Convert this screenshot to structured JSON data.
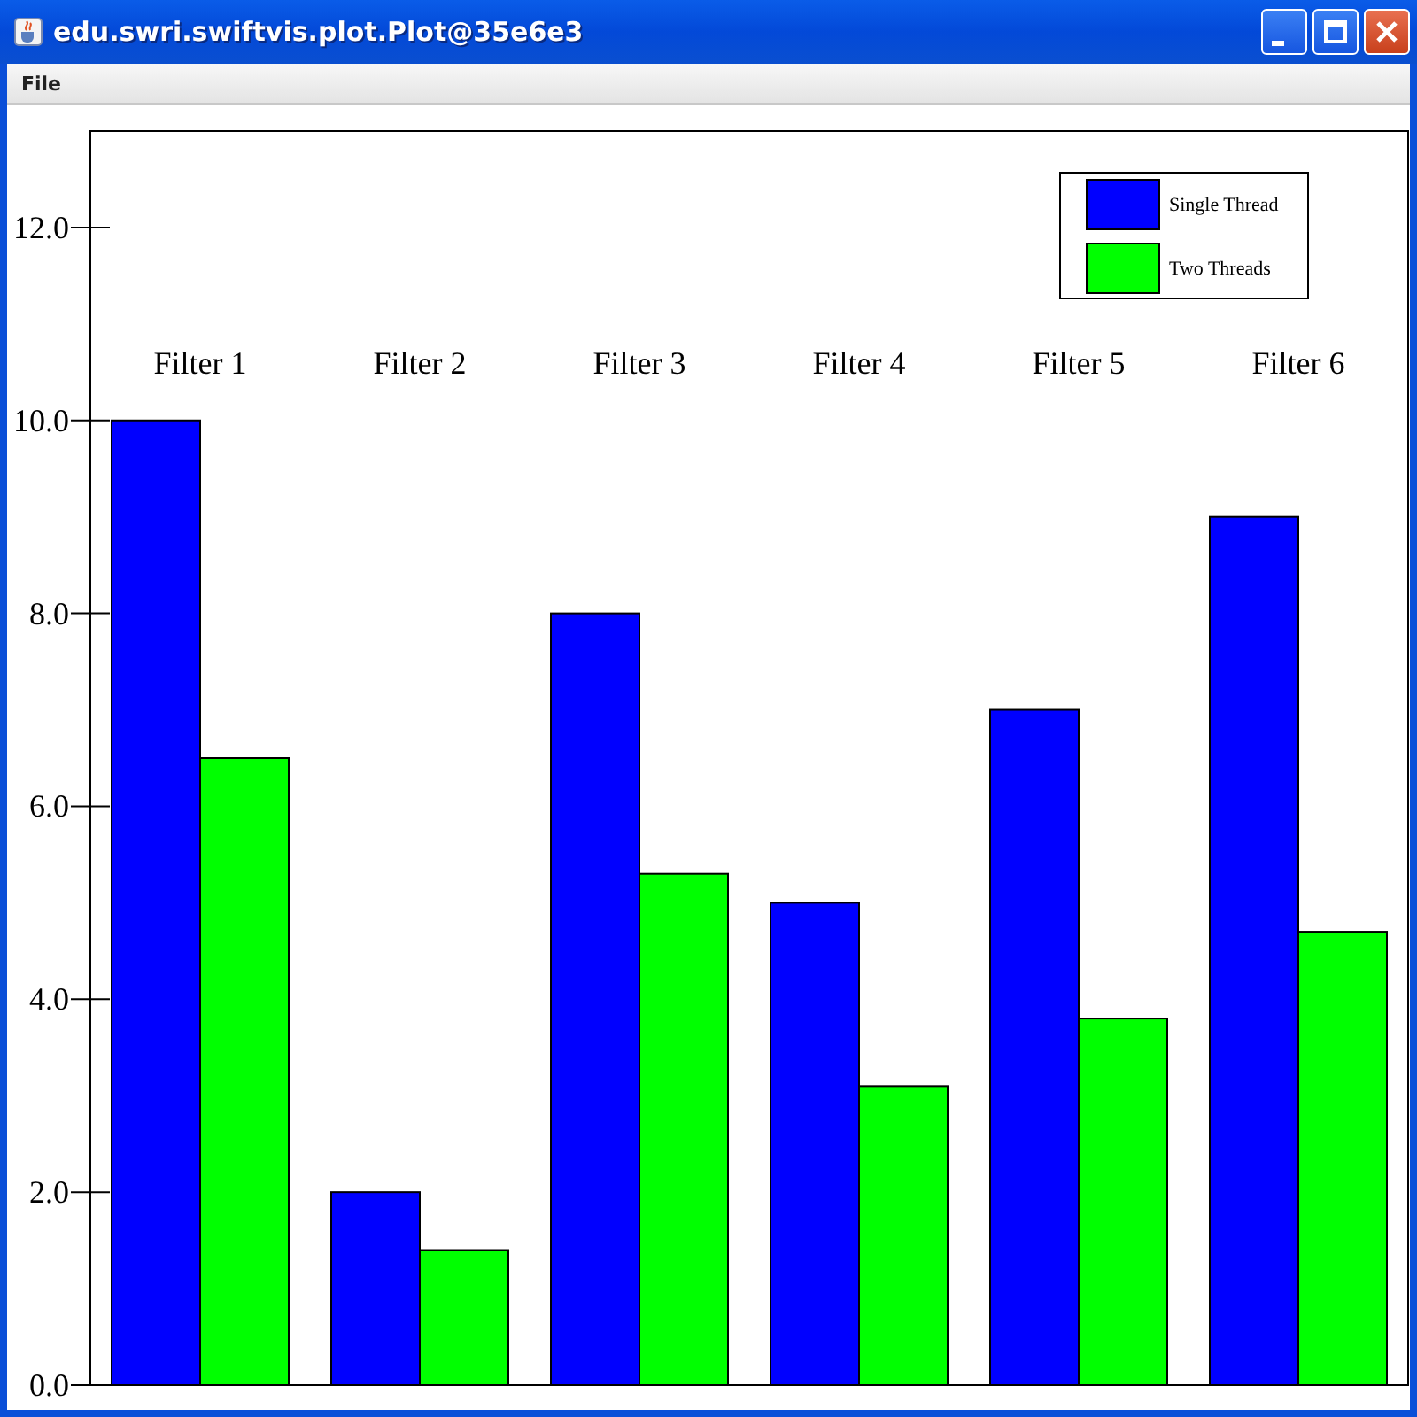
{
  "window": {
    "title": "edu.swri.swiftvis.plot.Plot@35e6e3"
  },
  "menu": [
    {
      "label": "File"
    }
  ],
  "plot": {
    "chart_data": {
      "type": "bar",
      "categories": [
        "Filter 1",
        "Filter 2",
        "Filter 3",
        "Filter 4",
        "Filter 5",
        "Filter 6"
      ],
      "series": [
        {
          "name": "Single Thread",
          "color": "#0000ff",
          "values": [
            10,
            2,
            8,
            5,
            7,
            9
          ]
        },
        {
          "name": "Two Threads",
          "color": "#00ff00",
          "values": [
            6.5,
            1.4,
            5.3,
            3.1,
            3.8,
            4.7
          ]
        }
      ],
      "ylim": [
        0,
        13
      ],
      "yticks": [
        {
          "value": 0,
          "label": "0.0"
        },
        {
          "value": 2,
          "label": "2.0"
        },
        {
          "value": 4,
          "label": "4.0"
        },
        {
          "value": 6,
          "label": "6.0"
        },
        {
          "value": 8,
          "label": "8.0"
        },
        {
          "value": 10,
          "label": "10.0"
        },
        {
          "value": 12,
          "label": "12.0"
        }
      ]
    }
  }
}
